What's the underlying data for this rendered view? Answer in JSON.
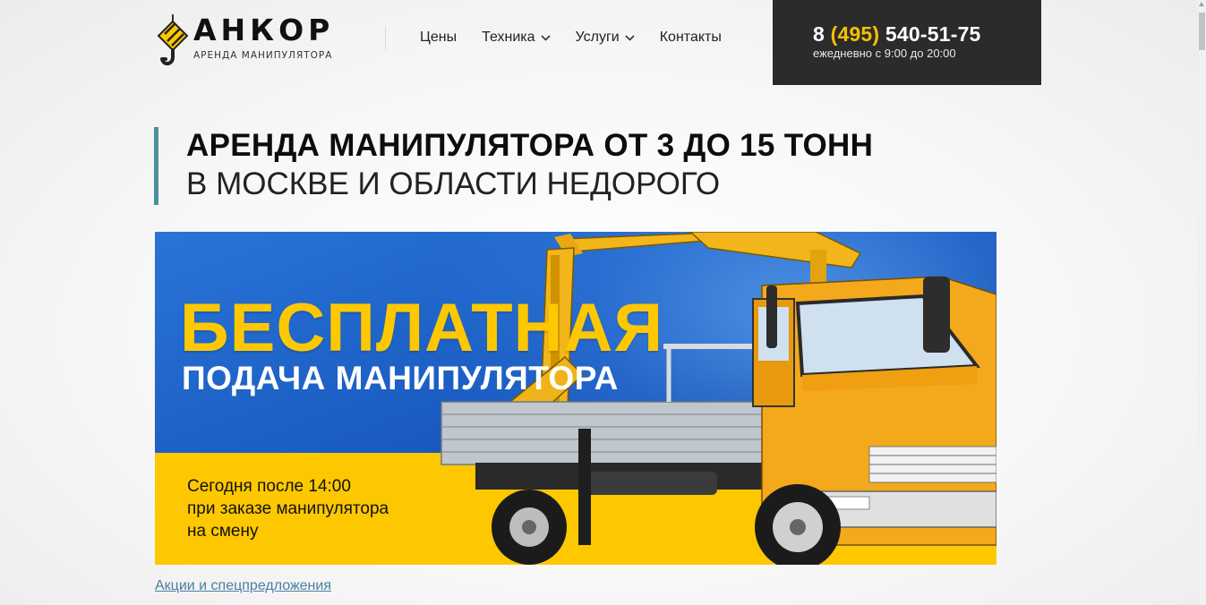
{
  "logo": {
    "name": "АНКОР",
    "tagline": "АРЕНДА МАНИПУЛЯТОРА"
  },
  "nav": {
    "items": [
      {
        "label": "Цены",
        "dropdown": false
      },
      {
        "label": "Техника",
        "dropdown": true
      },
      {
        "label": "Услуги",
        "dropdown": true
      },
      {
        "label": "Контакты",
        "dropdown": false
      }
    ]
  },
  "contact": {
    "phone_prefix": "8",
    "phone_code": "(495)",
    "phone_number": "540-51-75",
    "hours": "ежедневно с 9:00 до 20:00"
  },
  "heading": {
    "line1": "АРЕНДА МАНИПУЛЯТОРА ОТ 3 ДО 15 ТОНН",
    "line2": "В МОСКВЕ И ОБЛАСТИ НЕДОРОГО"
  },
  "banner": {
    "title": "БЕСПЛАТНАЯ",
    "subtitle": "ПОДАЧА МАНИПУЛЯТОРА",
    "note_lines": [
      "Сегодня после 14:00",
      "при заказе манипулятора",
      "на смену"
    ]
  },
  "promo_link": "Акции и спецпредложения",
  "colors": {
    "accent_yellow": "#fdc800",
    "phone_box": "#2b2b2b",
    "heading_bar": "#4c8f9e",
    "banner_blue": "#1a5cc2",
    "link": "#4a7fa0"
  }
}
